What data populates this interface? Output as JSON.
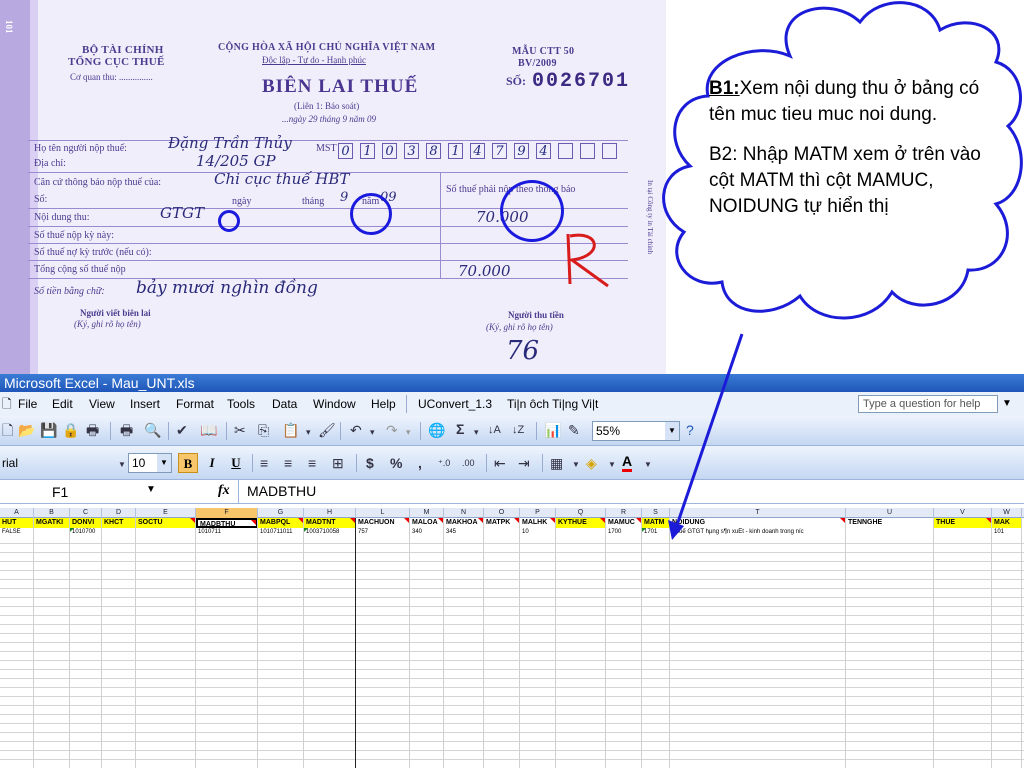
{
  "receipt": {
    "ministry": "BỘ TÀI CHÍNH",
    "department": "TỔNG CỤC THUẾ",
    "agency_label": "Cơ quan thu: ...............",
    "republic": "CỘNG HÒA XÃ HỘI CHỦ NGHĨA VIỆT NAM",
    "motto": "Độc lập - Tự do - Hạnh phúc",
    "form_code": "MẪU CTT 50",
    "form_year": "BV/2009",
    "title": "BIÊN LAI THUẾ",
    "copy": "(Liên 1: Báo soát)",
    "date_line": "...ngày 29 tháng 9 năm 09",
    "serial_label": "SỐ:",
    "serial_number": "0026701",
    "payer_label": "Họ tên người nộp thuế:",
    "payer_name": "Đặng Trần Thủy",
    "mst_label": "MST",
    "mst_digits": [
      "0",
      "1",
      "0",
      "3",
      "8",
      "1",
      "4",
      "7",
      "9",
      "4",
      "",
      "",
      ""
    ],
    "address_label": "Địa chỉ:",
    "address": "14/205 GP",
    "basis_label": "Căn cứ thông báo nộp thuế của:",
    "basis_value": "Chi cục thuế HBT",
    "so_label": "Số:",
    "ngay_label": "ngày",
    "thang_label": "tháng",
    "nam_label": "năm",
    "month_hand": "9",
    "year_hand": "09",
    "right_col_label": "Số thuế phải nộp theo thông báo",
    "content_label": "Nội dung thu:",
    "content_value": "GTGT",
    "content_amount": "70.000",
    "period_label": "Số thuế nộp kỳ này:",
    "debt_label": "Số thuế nợ kỳ trước (nếu có):",
    "total_label": "Tổng cộng số thuế nộp",
    "total_amount": "70.000",
    "words_label": "Số tiền bằng chữ:",
    "words_value": "bảy mươi nghìn đồng",
    "writer_label": "Người viết biên lai",
    "writer_sub": "(Ký, ghi rõ họ tên)",
    "collector_label": "Người thu tiền",
    "collector_sub": "(Ký, ghi rõ họ tên)",
    "signature": "76",
    "side_print": "In tại Công ty in Tài chính",
    "left_edge_text": "101"
  },
  "excel": {
    "title": "Microsoft Excel - Mau_UNT.xls",
    "menu": [
      "File",
      "Edit",
      "View",
      "Insert",
      "Format",
      "Tools",
      "Data",
      "Window",
      "Help",
      "UConvert_1.3",
      "Ti|n ôch Ti|ng Vi|t"
    ],
    "help_placeholder": "Type a question for help",
    "zoom": "55%",
    "font_name": "rial",
    "font_size": "10",
    "format_buttons": [
      "B",
      "I",
      "U"
    ],
    "currency_symbols": [
      "$",
      "%",
      ","
    ],
    "name_box": "F1",
    "fx_label": "fx",
    "formula": "MADBTHU",
    "columns": [
      "A",
      "B",
      "C",
      "D",
      "E",
      "F",
      "G",
      "H",
      "L",
      "M",
      "N",
      "O",
      "P",
      "Q",
      "R",
      "S",
      "T",
      "U",
      "V",
      "W"
    ],
    "fields": [
      "HUT",
      "MGATKI",
      "DONVI",
      "KHCT",
      "SOCTU",
      "MADBTHU",
      "MABPQL",
      "MADTNT",
      "MACHUON",
      "MALOA",
      "MAKHOA",
      "MATPK",
      "MALHK",
      "KYTHUE",
      "MAMUC",
      "MATM",
      "NOIDUNG",
      "TENNGHE",
      "THUE",
      "MAK"
    ],
    "row1": [
      "FALSE",
      "",
      "1010700",
      "",
      "",
      "1010711",
      "1010711011",
      "1003710058",
      "757",
      "340",
      "345",
      "",
      "10",
      "",
      "1700",
      "1701",
      "Thuế GTGT hµng s¶n xuÊt - kinh doanh trong n­íc",
      "",
      "",
      "101"
    ]
  },
  "callout": {
    "b1_label": "B1:",
    "b1_text": "Xem nội dung thu ở bảng có tên muc tieu muc noi dung.",
    "b2_text": "B2: Nhập MATM xem ở trên vào cột MATM thì cột MAMUC, NOIDUNG tự hiển thị"
  },
  "colors": {
    "cloud_stroke": "#1b1bd8",
    "excel_title": "#1f56b9",
    "highlight_yellow": "#ffff00",
    "selected_col": "#f7c66b"
  }
}
